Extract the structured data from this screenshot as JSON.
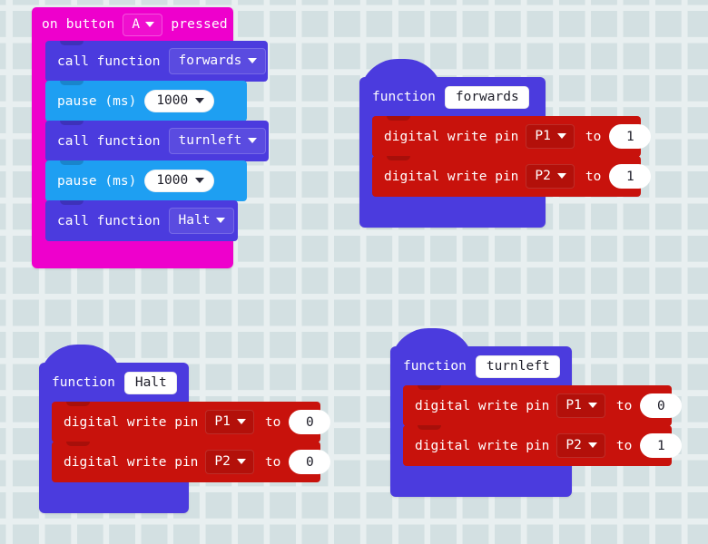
{
  "workspace": {
    "background_color": "#e8eff0",
    "grid": "dotted-cross"
  },
  "colors": {
    "event": "#ee00cc",
    "function_call": "#4b3bde",
    "function_def": "#4b3bde",
    "pause": "#1e9ff2",
    "pins": "#c8120c",
    "field_white": "#ffffff",
    "text": "#ffffff"
  },
  "scripts": [
    {
      "id": "on-button-pressed-script",
      "type": "event",
      "header": {
        "label_before": "on button",
        "dropdown_value": "A",
        "label_after": "pressed"
      },
      "statements": [
        {
          "kind": "call-function",
          "label": "call function",
          "dropdown_value": "forwards"
        },
        {
          "kind": "pause",
          "label": "pause (ms)",
          "value": "1000"
        },
        {
          "kind": "call-function",
          "label": "call function",
          "dropdown_value": "turnleft"
        },
        {
          "kind": "pause",
          "label": "pause (ms)",
          "value": "1000"
        },
        {
          "kind": "call-function",
          "label": "call function",
          "dropdown_value": "Halt"
        }
      ]
    },
    {
      "id": "function-forwards",
      "type": "function-definition",
      "header": {
        "label": "function",
        "name": "forwards"
      },
      "statements": [
        {
          "kind": "digital-write",
          "label": "digital write pin",
          "pin": "P1",
          "to_label": "to",
          "value": "1"
        },
        {
          "kind": "digital-write",
          "label": "digital write pin",
          "pin": "P2",
          "to_label": "to",
          "value": "1"
        }
      ]
    },
    {
      "id": "function-halt",
      "type": "function-definition",
      "header": {
        "label": "function",
        "name": "Halt"
      },
      "statements": [
        {
          "kind": "digital-write",
          "label": "digital write pin",
          "pin": "P1",
          "to_label": "to",
          "value": "0"
        },
        {
          "kind": "digital-write",
          "label": "digital write pin",
          "pin": "P2",
          "to_label": "to",
          "value": "0"
        }
      ]
    },
    {
      "id": "function-turnleft",
      "type": "function-definition",
      "header": {
        "label": "function",
        "name": "turnleft"
      },
      "statements": [
        {
          "kind": "digital-write",
          "label": "digital write pin",
          "pin": "P1",
          "to_label": "to",
          "value": "0"
        },
        {
          "kind": "digital-write",
          "label": "digital write pin",
          "pin": "P2",
          "to_label": "to",
          "value": "1"
        }
      ]
    }
  ]
}
